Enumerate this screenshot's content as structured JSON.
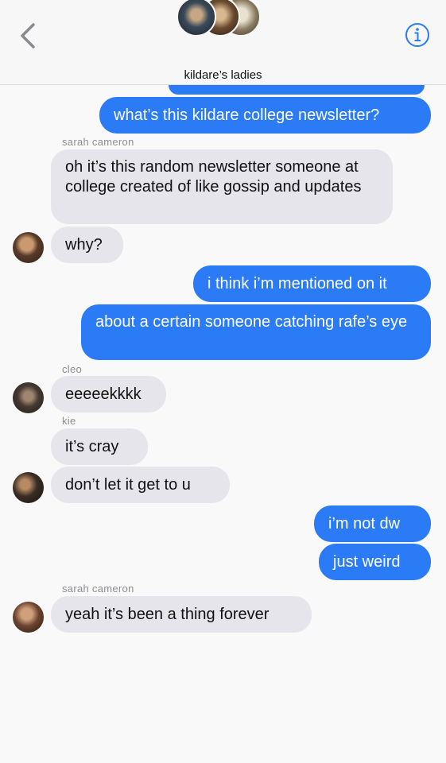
{
  "header": {
    "title": "kildare’s ladies",
    "back_icon": "chevron-left-icon",
    "info_icon": "info-icon",
    "accent": "#2a7bf5"
  },
  "messages": [
    {
      "text": "what’s this kildare college newsletter?"
    },
    {
      "sender": "sarah cameron",
      "text": "oh it’s this random newsletter someone at college created of like gossip and updates"
    },
    {
      "text": "why?"
    },
    {
      "text": "i think i’m mentioned on it"
    },
    {
      "text": "about a certain someone catching rafe’s eye"
    },
    {
      "sender": "cleo",
      "text": "eeeeekkkk"
    },
    {
      "sender": "kie",
      "text": "it’s cray"
    },
    {
      "text": "don’t let it get to u"
    },
    {
      "text": "i’m not dw"
    },
    {
      "text": "just weird"
    },
    {
      "sender": "sarah cameron",
      "text": "yeah it’s been a thing forever"
    }
  ]
}
